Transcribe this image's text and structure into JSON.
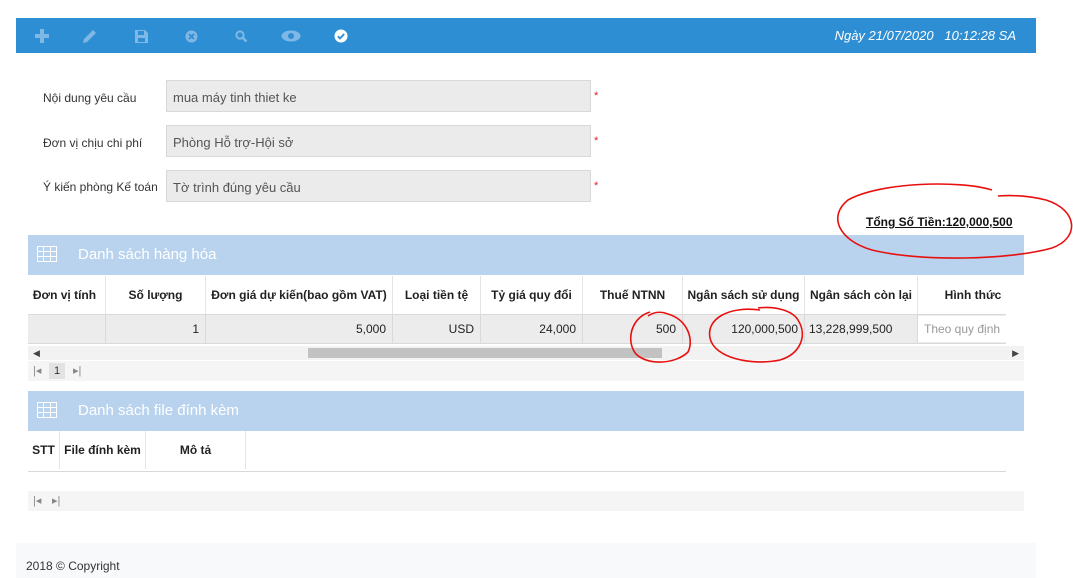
{
  "toolbar": {
    "icons": [
      "add-icon",
      "edit-icon",
      "save-icon",
      "cancel-icon",
      "search-icon",
      "view-icon",
      "approve-icon"
    ],
    "datetime": "Ngày 21/07/2020   10:12:28 SA"
  },
  "form": {
    "fields": [
      {
        "label": "Nội dung yêu cầu",
        "value": "mua máy tinh thiet ke",
        "required": "*"
      },
      {
        "label": "Đơn vị chịu chi phí",
        "value": "Phòng Hỗ trợ-Hội sở",
        "required": "*"
      },
      {
        "label": "Ý kiến phòng Kế toán",
        "value": "Tờ trình đúng yêu cầu",
        "required": "*"
      }
    ]
  },
  "total": "Tổng Số Tiền:120,000,500",
  "goods": {
    "title": "Danh sách hàng hóa",
    "columns": [
      "Đơn vị tính",
      "Số lượng",
      "Đơn giá dự kiến(bao gồm VAT)",
      "Loại tiền tệ",
      "Tỷ giá quy đổi",
      "Thuế NTNN",
      "Ngân sách sử dụng",
      "Ngân sách còn lại",
      "Hình thức"
    ],
    "rows": [
      {
        "unit": "",
        "quantity": "1",
        "price": "5,000",
        "currency": "USD",
        "rate": "24,000",
        "tax": "500",
        "budget_used": "120,000,500",
        "budget_left": "13,228,999,500",
        "form_placeholder": "Theo quy định"
      }
    ],
    "page": "1"
  },
  "files": {
    "title": "Danh sách file đính kèm",
    "columns": [
      "STT",
      "File đính kèm",
      "Mô tả"
    ]
  },
  "footer": {
    "copyright": "2018 © Copyright"
  },
  "colors": {
    "toolbar": "#2e8ed3",
    "section_header": "#b9d3ee",
    "annotation": "#e8100f",
    "required": "#e02020"
  }
}
